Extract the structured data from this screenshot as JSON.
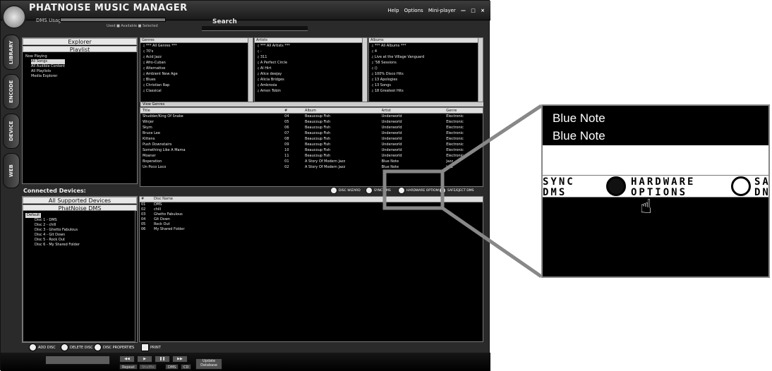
{
  "app": {
    "title": "PHATNOISE MUSIC MANAGER",
    "dms_usage": "DMS Usage",
    "legend": "Used ■ Available ■ Selected",
    "search_label": "Search",
    "top_links": [
      "Help",
      "Options",
      "Mini-player"
    ]
  },
  "side_tabs": [
    "LIBRARY",
    "ENCODE",
    "DEVICE",
    "WEB"
  ],
  "explorer": {
    "header": "Explorer",
    "subheader": "Playlist",
    "items": [
      "Now Playing",
      "All Songs",
      "All Audible Content",
      "All Playlists",
      "Media Explorer"
    ]
  },
  "genres": {
    "header": "Genres",
    "items": [
      "*** All Genres ***",
      "70's",
      "Acid Jazz",
      "Afro-Cuban",
      "Alternative",
      "Ambient New Age",
      "Blues",
      "Christian Rap",
      "Classical"
    ]
  },
  "artists": {
    "header": "Artists",
    "items": [
      "*** All Artists ***",
      "-",
      "311",
      "A Perfect Circle",
      "Al Hirt",
      "Alice deejay",
      "Alicia Bridges",
      "Ambrosia",
      "Amon Tobin"
    ]
  },
  "albums": {
    "header": "Albums",
    "items": [
      "*** All Albums ***",
      "4",
      "Live at the Village Vanguard",
      "'58 Sessions",
      "()",
      "100% Disco Hits",
      "13 Apologies",
      "13 Songs",
      "18 Greatest Hits"
    ]
  },
  "view_genres": "View Genres",
  "tracks": {
    "headers": [
      "Title",
      "#",
      "Album",
      "Artist",
      "Genre"
    ],
    "rows": [
      [
        "Shudder/King Of Snake",
        "04",
        "Beaucoup Fish",
        "Underworld",
        "Electronic"
      ],
      [
        "Winjer",
        "05",
        "Beaucoup Fish",
        "Underworld",
        "Electronic"
      ],
      [
        "Skym",
        "06",
        "Beaucoup Fish",
        "Underworld",
        "Electronic"
      ],
      [
        "Bruce Lee",
        "07",
        "Beaucoup Fish",
        "Underworld",
        "Electronic"
      ],
      [
        "Kittens",
        "08",
        "Beaucoup Fish",
        "Underworld",
        "Electronic"
      ],
      [
        "Push Downstairs",
        "09",
        "Beaucoup Fish",
        "Underworld",
        "Electronic"
      ],
      [
        "Something Like A Mama",
        "10",
        "Beaucoup Fish",
        "Underworld",
        "Electronic"
      ],
      [
        "Moaner",
        "11",
        "Beaucoup Fish",
        "Underworld",
        "Electronic"
      ],
      [
        "Boperation",
        "01",
        "A Story Of Modern Jazz",
        "Blue Note",
        "Jazz"
      ],
      [
        "Un Poco Loco",
        "02",
        "A Story Of Modern Jazz",
        "Blue Note",
        "Jazz"
      ]
    ]
  },
  "tools": {
    "disc_wizard": "DISC WIZARD",
    "sync_dms": "SYNC DMS",
    "hardware_options": "HARDWARE OPTIONS",
    "safe_eject": "SAFE/EJECT DMS"
  },
  "connected": {
    "label": "Connected Devices:",
    "header": "All Supported Devices",
    "subheader": "PhatNoise DMS",
    "root": "Default",
    "discs": [
      "Disc 1 - DMS",
      "Disc 2 - chill",
      "Disc 3 - Ghetto Fabulous",
      "Disc 4 - Git Down",
      "Disc 5 - Rock Out",
      "Disc 6 - My Shared Folder"
    ]
  },
  "disc_table": {
    "headers": [
      "#",
      "Disc Name"
    ],
    "rows": [
      [
        "01",
        "DMS"
      ],
      [
        "02",
        "chill"
      ],
      [
        "03",
        "Ghetto Fabulous"
      ],
      [
        "04",
        "Git Down"
      ],
      [
        "05",
        "Rock Out"
      ],
      [
        "06",
        "My Shared Folder"
      ]
    ]
  },
  "bottom": {
    "add_disc": "ADD DISC",
    "delete_disc": "DELETE DISC",
    "disc_properties": "DISC PROPERTIES",
    "print": "PRINT"
  },
  "player": {
    "repeat": "Repeat",
    "shuffle": "Shuffle",
    "dms": "DMS",
    "cd": "CD",
    "update_database": "Update Database"
  },
  "zoom": {
    "line1": "Blue Note",
    "line2": "Blue Note",
    "sync_top": "SYNC",
    "sync_bottom": "DMS",
    "hardware_top": "HARDWARE",
    "hardware_bottom": "OPTIONS",
    "safe_top": "SA",
    "safe_bottom": "DN"
  }
}
